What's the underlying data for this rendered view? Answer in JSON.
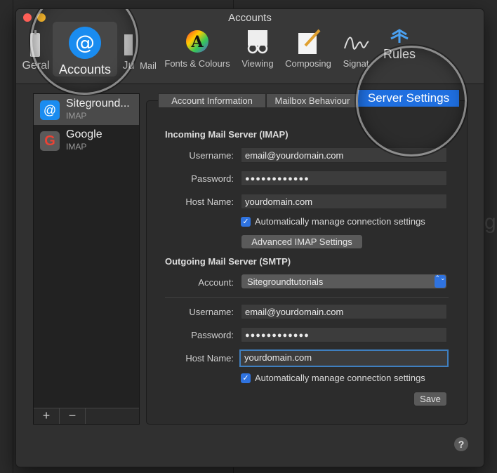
{
  "window": {
    "title": "Accounts"
  },
  "toolbar": {
    "general": "Geral",
    "accounts": "Accounts",
    "junk": "Ju",
    "mail": "Mail",
    "fonts": "Fonts & Colours",
    "viewing": "Viewing",
    "composing": "Composing",
    "signatures": "Signat",
    "rules": "Rules",
    "at_symbol": "@",
    "fonts_glyph": "A"
  },
  "sidebar": {
    "accounts": [
      {
        "name": "Siteground...",
        "type": "IMAP",
        "icon": "@"
      },
      {
        "name": "Google",
        "type": "IMAP",
        "icon": "G"
      }
    ],
    "add": "+",
    "remove": "−"
  },
  "tabs": {
    "account_info": "Account Information",
    "mailbox": "Mailbox Behaviour",
    "server": "Server Settings"
  },
  "incoming": {
    "title": "Incoming Mail Server (IMAP)",
    "username_label": "Username:",
    "username": "email@yourdomain.com",
    "password_label": "Password:",
    "password": "●●●●●●●●●●●●",
    "host_label": "Host Name:",
    "host": "yourdomain.com",
    "auto_manage": "Automatically manage connection settings",
    "advanced": "Advanced IMAP Settings"
  },
  "outgoing": {
    "title": "Outgoing Mail Server (SMTP)",
    "account_label": "Account:",
    "account": "Sitegroundtutorials",
    "username_label": "Username:",
    "username": "email@yourdomain.com",
    "password_label": "Password:",
    "password": "●●●●●●●●●●●●",
    "host_label": "Host Name:",
    "host": "yourdomain.com",
    "auto_manage": "Automatically manage connection settings"
  },
  "save": "Save",
  "help": "?",
  "checkmark": "✓",
  "select_arrows": "⌃⌄",
  "background_ghost_text": "ge",
  "colors": {
    "accent": "#1f6fe0",
    "close": "#ff5f57",
    "minimize": "#febc2e"
  }
}
